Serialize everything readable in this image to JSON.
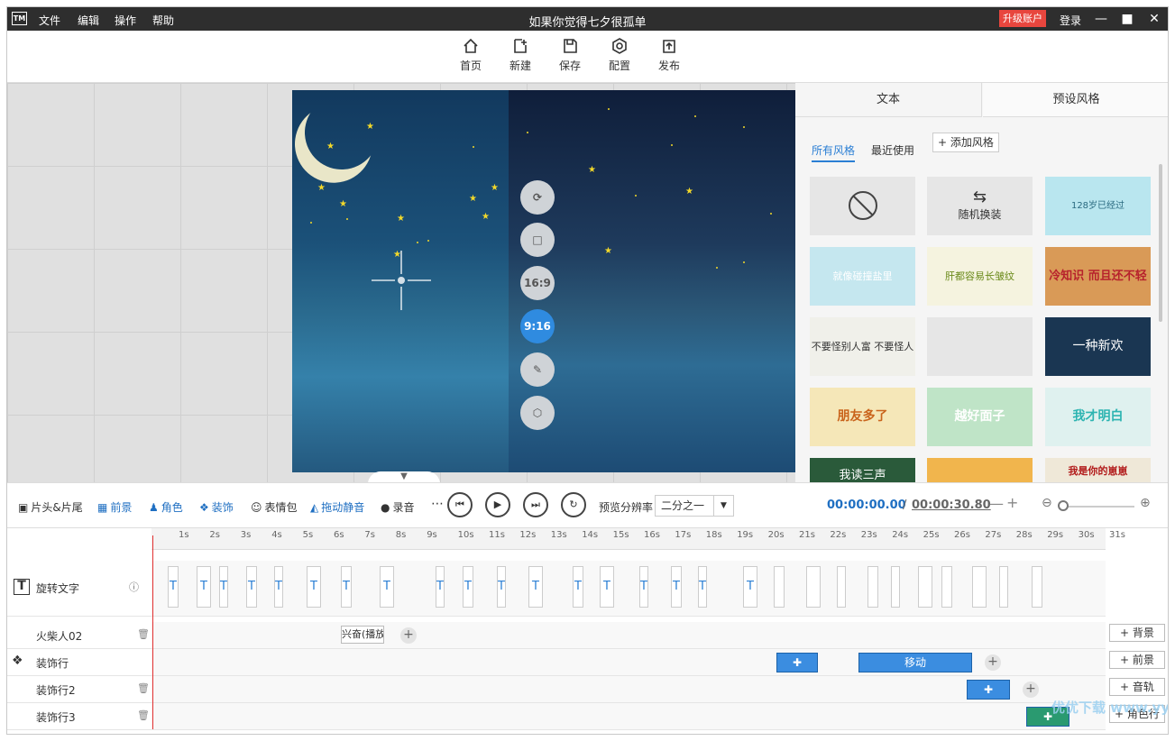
{
  "app": {
    "logo": "TM",
    "title": "如果你觉得七夕很孤单",
    "menus": [
      "文件",
      "编辑",
      "操作",
      "帮助"
    ],
    "upgrade": "升级账户",
    "login": "登录"
  },
  "toolbar": {
    "items": [
      {
        "label": "首页",
        "icon": "home-icon"
      },
      {
        "label": "新建",
        "icon": "new-icon"
      },
      {
        "label": "保存",
        "icon": "save-icon"
      },
      {
        "label": "配置",
        "icon": "config-icon"
      },
      {
        "label": "发布",
        "icon": "publish-icon"
      }
    ]
  },
  "canvas": {
    "side_buttons": [
      "",
      "",
      "16:9",
      "9:16",
      "",
      ""
    ],
    "active_ratio": "9:16"
  },
  "right_panel": {
    "tabs": [
      "文本",
      "预设风格"
    ],
    "subtabs": [
      "所有风格",
      "最近使用"
    ],
    "add_style": "添加风格",
    "random": "随机换装",
    "thumbs": [
      {
        "text": ""
      },
      {
        "text": "随机换装"
      },
      {
        "text": "128岁已经过"
      },
      {
        "text": "就像碰撞盐里"
      },
      {
        "text": "肝都容易长皱纹"
      },
      {
        "text": "冷知识 而且还不轻"
      },
      {
        "text": "不要怪别人富 不要怪人家有钱!"
      },
      {
        "text": ""
      },
      {
        "text": "一种新欢"
      },
      {
        "text": "朋友多了"
      },
      {
        "text": "越好面子"
      },
      {
        "text": "我才明白"
      },
      {
        "text": "我读三声"
      },
      {
        "text": ""
      },
      {
        "text": "我是你的崽崽"
      }
    ]
  },
  "controls": {
    "items": [
      "片头&片尾",
      "前景",
      "角色",
      "装饰",
      "表情包",
      "拖动静音",
      "录音"
    ],
    "preview_label": "预览分辨率",
    "preview_value": "二分之一",
    "time_current": "00:00:00.00",
    "time_sep": "/",
    "time_total": "00:00:30.80"
  },
  "timeline": {
    "ticks": [
      "1s",
      "2s",
      "3s",
      "4s",
      "5s",
      "6s",
      "7s",
      "8s",
      "9s",
      "10s",
      "11s",
      "12s",
      "13s",
      "14s",
      "15s",
      "16s",
      "17s",
      "18s",
      "19s",
      "20s",
      "21s",
      "22s",
      "23s",
      "24s",
      "25s",
      "26s",
      "27s",
      "28s",
      "29s",
      "30s",
      "31s"
    ],
    "rows": [
      {
        "label": "旋转文字"
      },
      {
        "label": "火柴人02"
      },
      {
        "label": "装饰行"
      },
      {
        "label": "装饰行2"
      },
      {
        "label": "装饰行3"
      }
    ],
    "clip_text": "兴奋(播放",
    "move_label": "移动",
    "add_buttons": [
      "背景",
      "前景",
      "音轨",
      "角色行"
    ]
  },
  "watermark": "优优下载 www.yyxt.com"
}
